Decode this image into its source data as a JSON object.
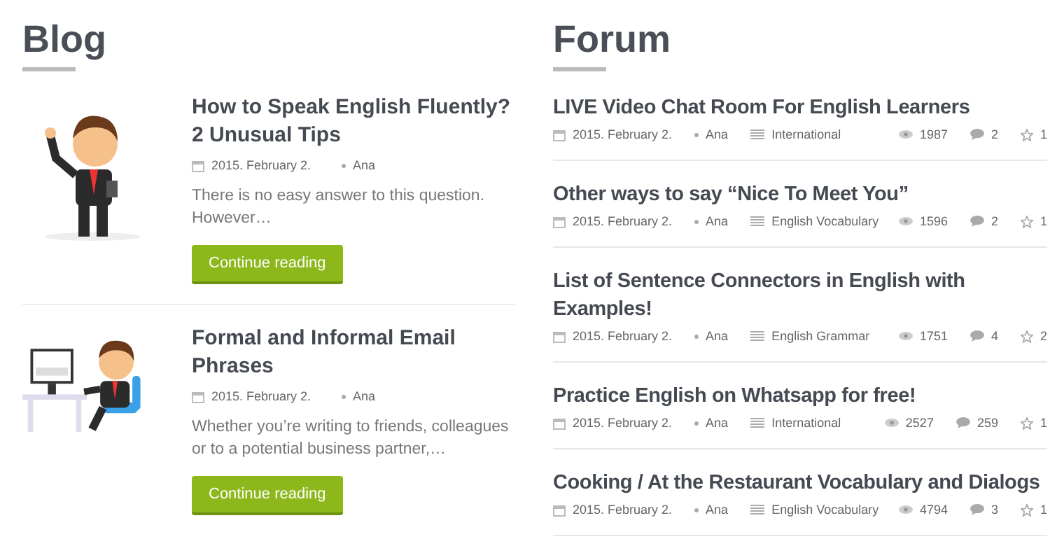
{
  "blog": {
    "heading": "Blog",
    "posts": [
      {
        "kind": "pointing",
        "title": "How to Speak English Fluently? 2 Unusual Tips",
        "date": "2015. February 2.",
        "author": "Ana",
        "excerpt": "There is no easy answer to this question. However…",
        "button": "Continue reading"
      },
      {
        "kind": "desk",
        "title": "Formal and Informal Email Phrases",
        "date": "2015. February 2.",
        "author": "Ana",
        "excerpt": "Whether you’re writing to friends, colleagues or to a potential business partner,…",
        "button": "Continue reading"
      }
    ]
  },
  "forum": {
    "heading": "Forum",
    "topics": [
      {
        "title": "LIVE Video Chat Room For English Learners",
        "date": "2015. February 2.",
        "author": "Ana",
        "category": "International",
        "views": "1987",
        "comments": "2",
        "likes": "1"
      },
      {
        "title": "Other ways to say “Nice To Meet You”",
        "date": "2015. February 2.",
        "author": "Ana",
        "category": "English Vocabulary",
        "views": "1596",
        "comments": "2",
        "likes": "1"
      },
      {
        "title": "List of Sentence Connectors in English with Examples!",
        "date": "2015. February 2.",
        "author": "Ana",
        "category": "English Grammar",
        "views": "1751",
        "comments": "4",
        "likes": "2"
      },
      {
        "title": "Practice English on Whatsapp for free!",
        "date": "2015. February 2.",
        "author": "Ana",
        "category": "International",
        "views": "2527",
        "comments": "259",
        "likes": "1"
      },
      {
        "title": "Cooking / At the Restaurant Vocabulary and Dialogs",
        "date": "2015. February 2.",
        "author": "Ana",
        "category": "English Vocabulary",
        "views": "4794",
        "comments": "3",
        "likes": "1"
      }
    ]
  }
}
